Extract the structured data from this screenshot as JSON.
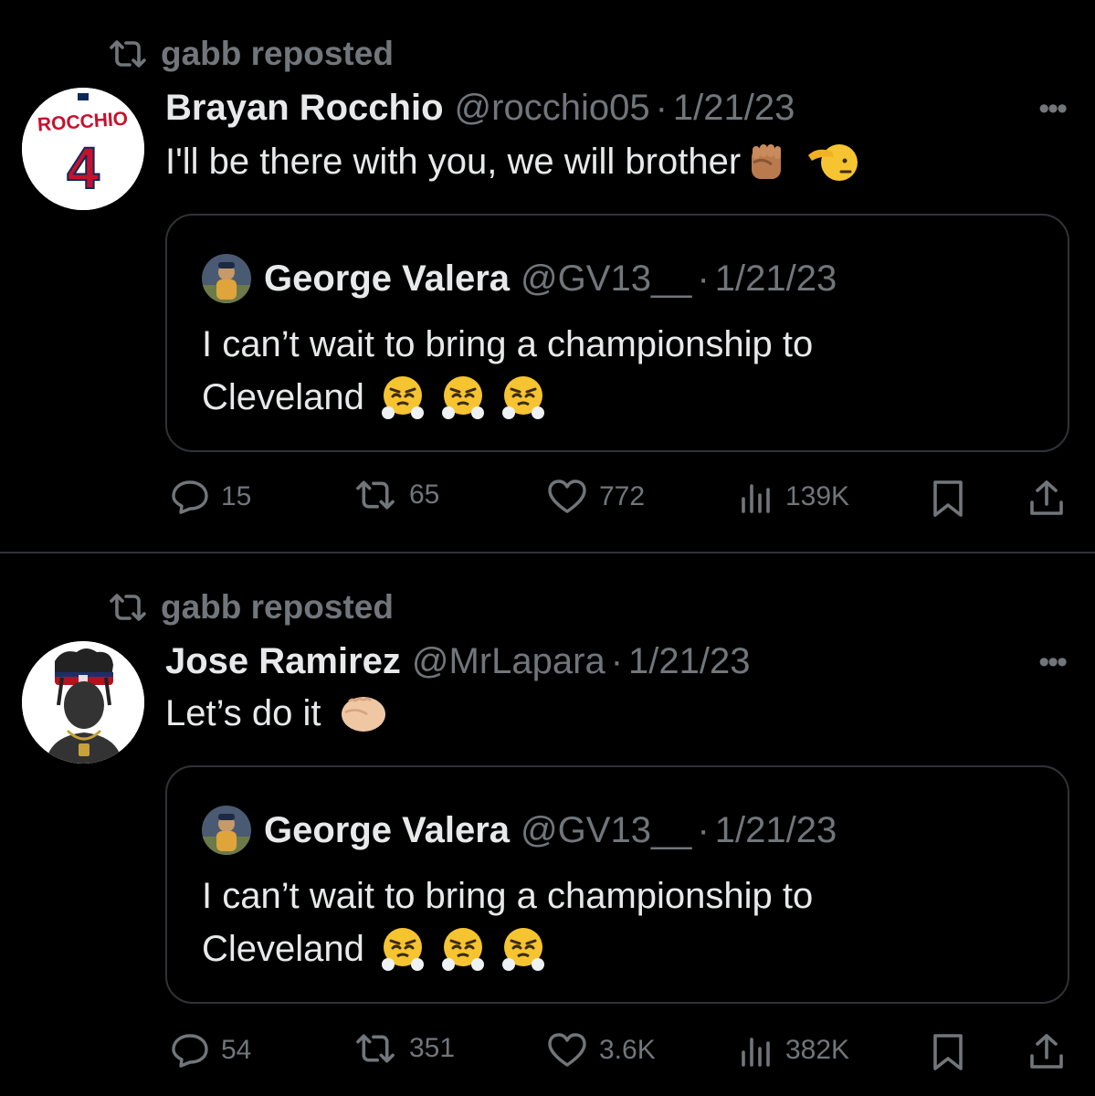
{
  "tweets": [
    {
      "repost_label": "gabb reposted",
      "author_name": "Brayan Rocchio",
      "author_handle": "@rocchio05",
      "date": "1/21/23",
      "text": "I'll be there with you, we will brother",
      "avatar_jersey_name": "ROCCHIO",
      "avatar_jersey_number": "4",
      "quote": {
        "author_name": "George Valera",
        "author_handle": "@GV13__",
        "date": "1/21/23",
        "text_line1": "I can’t wait to bring a championship to",
        "text_line2": "Cleveland"
      },
      "stats": {
        "replies": "15",
        "reposts": "65",
        "likes": "772",
        "views": "139K"
      }
    },
    {
      "repost_label": "gabb reposted",
      "author_name": "Jose Ramirez",
      "author_handle": "@MrLapara",
      "date": "1/21/23",
      "text": "Let’s do it",
      "quote": {
        "author_name": "George Valera",
        "author_handle": "@GV13__",
        "date": "1/21/23",
        "text_line1": "I can’t wait to bring a championship to",
        "text_line2": "Cleveland"
      },
      "stats": {
        "replies": "54",
        "reposts": "351",
        "likes": "3.6K",
        "views": "382K"
      }
    }
  ],
  "common": {
    "dot": "·",
    "more": "•••"
  },
  "colors": {
    "background": "#000000",
    "text": "#e7e9ea",
    "muted": "#71767b",
    "border": "#2f3336",
    "jersey_red": "#c8102e"
  },
  "icons": [
    "repost-icon",
    "more-icon",
    "reply-icon",
    "like-icon",
    "views-icon",
    "bookmark-icon",
    "share-icon",
    "raised-fist-emoji",
    "saluting-face-emoji",
    "steam-face-emoji",
    "oncoming-fist-emoji"
  ]
}
